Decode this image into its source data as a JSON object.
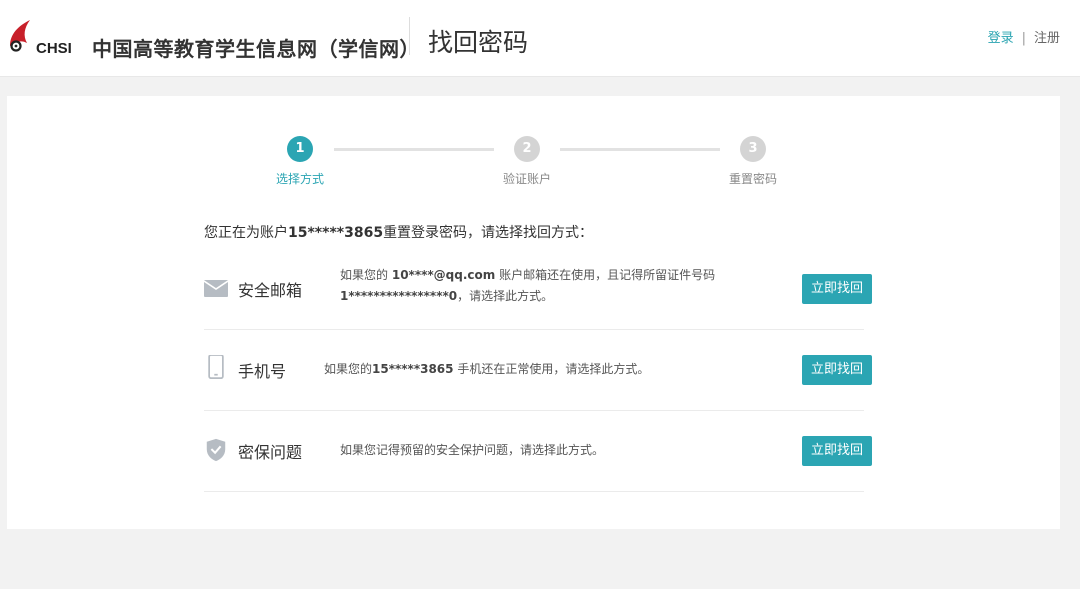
{
  "header": {
    "logo_text": "CHSI",
    "site_name": "中国高等教育学生信息网（学信网）",
    "page_title": "找回密码",
    "login_label": "登录",
    "separator": "|",
    "register_label": "注册"
  },
  "steps": [
    {
      "number": "1",
      "label": "选择方式"
    },
    {
      "number": "2",
      "label": "验证账户"
    },
    {
      "number": "3",
      "label": "重置密码"
    }
  ],
  "intro": {
    "prefix": "您正在为账户",
    "account": "15*****3865",
    "suffix": "重置登录密码，请选择找回方式："
  },
  "options": [
    {
      "icon": "envelope-icon",
      "title": "安全邮箱",
      "desc_pre": "如果您的",
      "email": "10****@qq.com",
      "desc_mid": " 账户邮箱还在使用，且记得所留证件号码",
      "id_number": "1****************0",
      "desc_end": "，请选择此方式。",
      "button": "立即找回"
    },
    {
      "icon": "phone-icon",
      "title": "手机号",
      "desc_pre": "如果您的",
      "phone": "15*****3865",
      "desc_end": " 手机还在正常使用，请选择此方式。",
      "button": "立即找回"
    },
    {
      "icon": "shield-check-icon",
      "title": "密保问题",
      "desc": "如果您记得预留的安全保护问题，请选择此方式。",
      "button": "立即找回"
    }
  ],
  "colors": {
    "accent": "#2ba5b3",
    "inactive_step": "#d4d4d4",
    "background": "#f2f2f2"
  }
}
